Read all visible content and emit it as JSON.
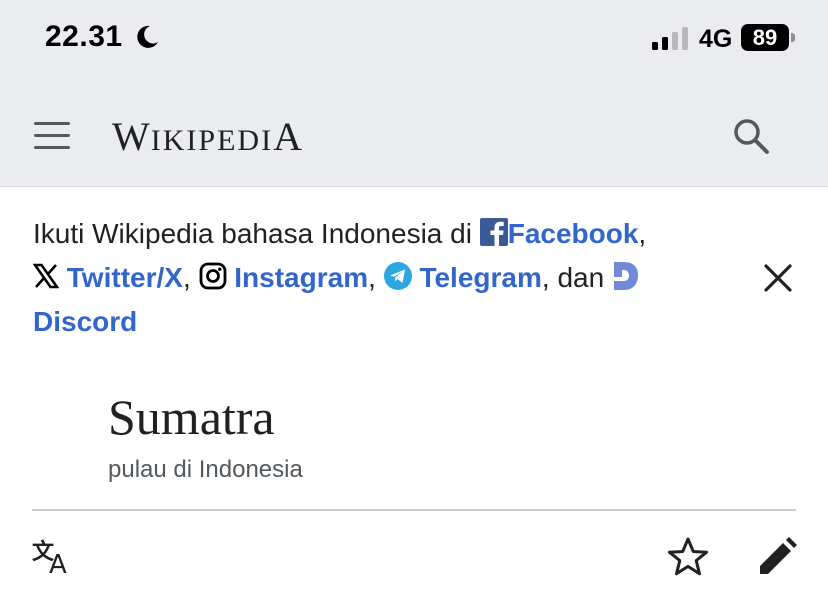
{
  "status": {
    "time": "22.31",
    "network": "4G",
    "battery": "89"
  },
  "header": {
    "logo_first": "W",
    "logo_rest": "IKIPEDI",
    "logo_last": "A"
  },
  "notice": {
    "prefix": "Ikuti Wikipedia bahasa Indonesia di",
    "facebook": "Facebook",
    "twitter": "Twitter/X",
    "instagram": "Instagram",
    "telegram": "Telegram",
    "and": "dan",
    "discord": "Discord"
  },
  "article": {
    "title": "Sumatra",
    "description": "pulau di Indonesia"
  },
  "colors": {
    "link": "#3366cc",
    "chrome": "#eaecf0"
  }
}
